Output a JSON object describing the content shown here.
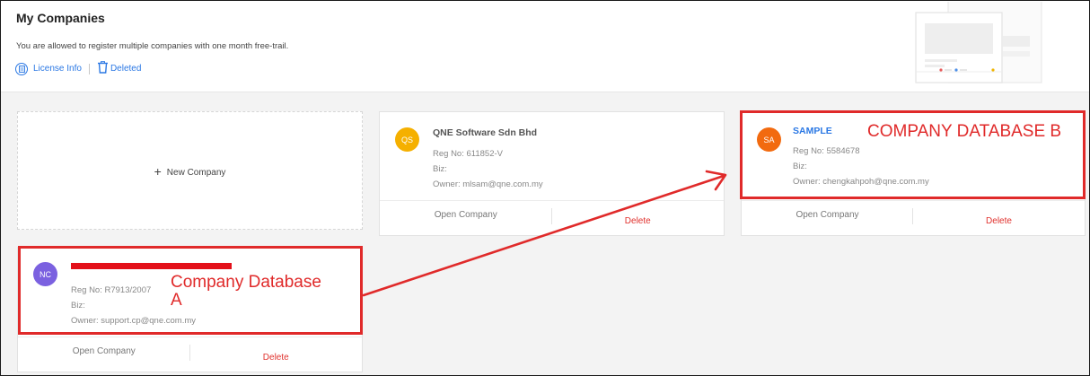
{
  "header": {
    "title": "My Companies",
    "subtitle": "You are allowed to register multiple companies with one month free-trail.",
    "license_info": "License Info",
    "deleted": "Deleted"
  },
  "new_company": {
    "label": "New Company"
  },
  "companies": [
    {
      "initials": "QS",
      "avatar_color": "#f5b000",
      "name": "QNE Software Sdn Bhd",
      "reg": "Reg No: 611852-V",
      "biz": "Biz:",
      "owner": "Owner: mlsam@qne.com.my",
      "open_label": "Open Company",
      "delete_label": "Delete"
    },
    {
      "initials": "SA",
      "avatar_color": "#f26a0f",
      "name": "SAMPLE",
      "reg": "Reg No: 5584678",
      "biz": "Biz:",
      "owner": "Owner: chengkahpoh@qne.com.my",
      "open_label": "Open Company",
      "delete_label": "Delete"
    },
    {
      "initials": "NC",
      "avatar_color": "#7b61e0",
      "name": "",
      "reg": "Reg No: R7913/2007",
      "biz": "Biz:",
      "owner": "Owner: support.cp@qne.com.my",
      "open_label": "Open Company",
      "delete_label": "Delete"
    }
  ],
  "annotations": {
    "database_b": "COMPANY DATABASE B",
    "database_a_line1": "Company Database",
    "database_a_line2": "A",
    "color": "#e02a2a"
  }
}
